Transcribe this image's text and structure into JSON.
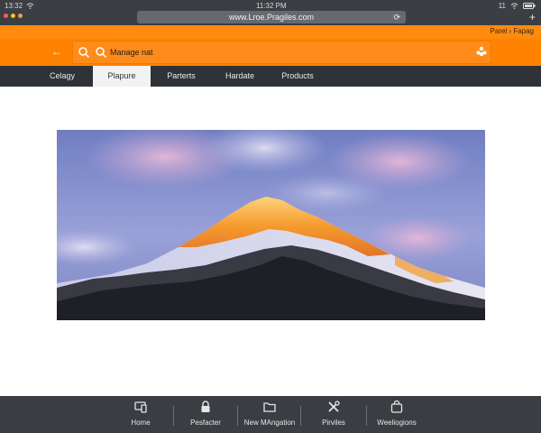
{
  "status_bar": {
    "time_left": "13:32",
    "time_center": "11:32 PM",
    "time_right": "11"
  },
  "browser": {
    "url": "www.Lroe.Pragiles.com"
  },
  "breadcrumb": "Parel › Fapag",
  "search": {
    "text": "Manage nat"
  },
  "tabs": [
    {
      "label": "Celagy"
    },
    {
      "label": "Plapure"
    },
    {
      "label": "Parterts"
    },
    {
      "label": "Hardate"
    },
    {
      "label": "Products"
    }
  ],
  "active_tab": 1,
  "hero": {
    "subject": "mountain-sunset-photo",
    "colors": {
      "sky": "#8a8fd0",
      "glow": "#f59a2c",
      "rock": "#2a2a30"
    }
  },
  "bottom_nav": [
    {
      "label": "Home",
      "icon": "devices-icon"
    },
    {
      "label": "Pesfacter",
      "icon": "lock-icon"
    },
    {
      "label": "New MAngation",
      "icon": "folder-icon"
    },
    {
      "label": "Pirviles",
      "icon": "tools-icon"
    },
    {
      "label": "Weeliogions",
      "icon": "bag-icon"
    }
  ],
  "colors": {
    "accent": "#ff8200",
    "dark_bar": "#2f3338"
  }
}
